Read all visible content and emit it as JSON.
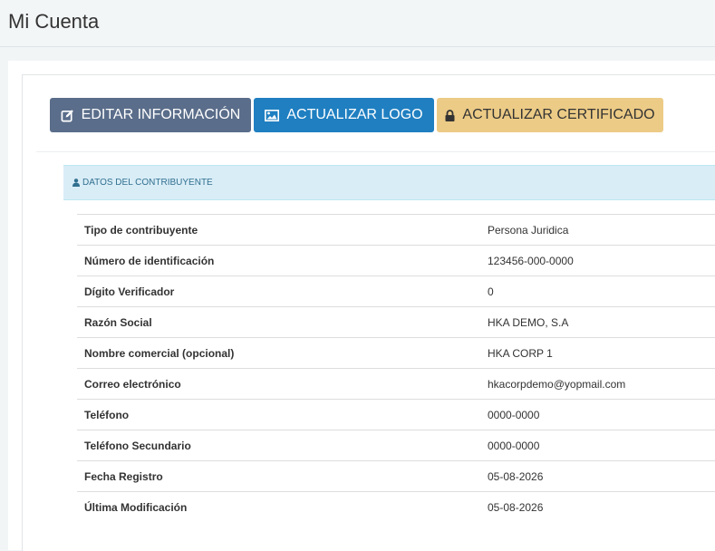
{
  "page": {
    "title": "Mi Cuenta"
  },
  "toolbar": {
    "edit_label": "EDITAR INFORMACIÓN",
    "logo_label": "ACTUALIZAR LOGO",
    "cert_label": "ACTUALIZAR CERTIFICADO"
  },
  "section": {
    "title": "DATOS DEL CONTRIBUYENTE"
  },
  "colors": {
    "edit_button": "#5a6d8a",
    "logo_button": "#1f7fc1",
    "cert_button": "#eccb86",
    "section_header_bg": "#d9edf7",
    "section_header_text": "#31708f"
  },
  "icons": {
    "edit": "pencil-square-icon",
    "logo": "image-icon",
    "cert": "lock-icon",
    "section": "user-icon"
  },
  "rows": [
    {
      "label": "Tipo de contribuyente",
      "value": "Persona Juridica"
    },
    {
      "label": "Número de identificación",
      "value": "123456-000-0000"
    },
    {
      "label": "Dígito Verificador",
      "value": "0"
    },
    {
      "label": "Razón Social",
      "value": "HKA DEMO, S.A"
    },
    {
      "label": "Nombre comercial (opcional)",
      "value": "HKA CORP 1"
    },
    {
      "label": "Correo electrónico",
      "value": "hkacorpdemo@yopmail.com"
    },
    {
      "label": "Teléfono",
      "value": "0000-0000"
    },
    {
      "label": "Teléfono Secundario",
      "value": "0000-0000"
    },
    {
      "label": "Fecha Registro",
      "value": "05-08-2026"
    },
    {
      "label": "Última Modificación",
      "value": "05-08-2026"
    }
  ]
}
